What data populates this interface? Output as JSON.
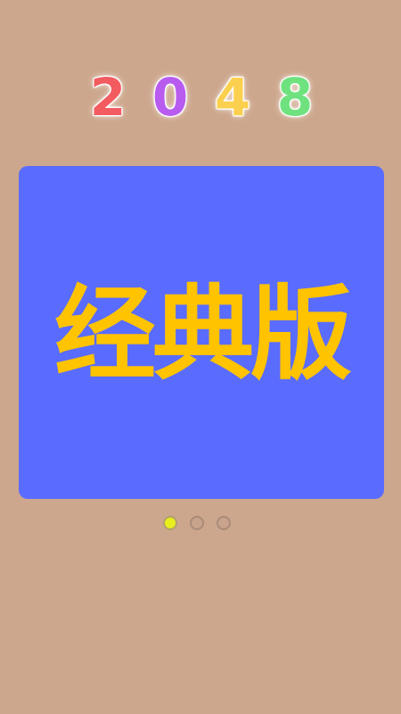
{
  "title": {
    "digits": [
      {
        "text": "2",
        "color": "#f25b60"
      },
      {
        "text": "0",
        "color": "#b85cf0"
      },
      {
        "text": "4",
        "color": "#fbd04f"
      },
      {
        "text": "8",
        "color": "#6fe27f"
      }
    ]
  },
  "mode_card": {
    "label": "经典版",
    "background_color": "#5a6cfe",
    "text_color": "#ffc300"
  },
  "pager": {
    "page_count": 3,
    "active_index": 0,
    "active_color": "#e8ee1c"
  },
  "colors": {
    "background": "#cda78d"
  }
}
